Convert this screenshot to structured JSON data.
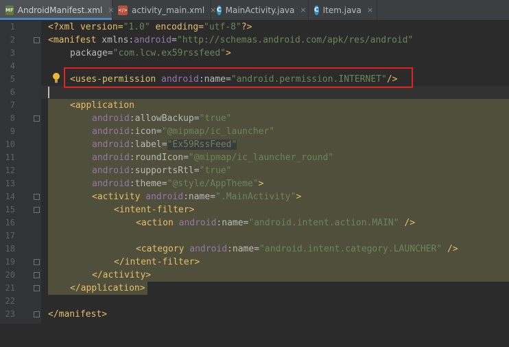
{
  "tabs": [
    {
      "label": "AndroidManifest.xml",
      "icon": "manifest-file-icon",
      "active": true
    },
    {
      "label": "activity_main.xml",
      "icon": "layout-xml-icon",
      "active": false
    },
    {
      "label": "MainActivity.java",
      "icon": "java-class-icon",
      "active": false
    },
    {
      "label": "Item.java",
      "icon": "java-class-icon",
      "active": false
    }
  ],
  "tab_close": "×",
  "lines": [
    {
      "n": "1"
    },
    {
      "n": "2"
    },
    {
      "n": "3"
    },
    {
      "n": "4"
    },
    {
      "n": "5"
    },
    {
      "n": "6"
    },
    {
      "n": "7"
    },
    {
      "n": "8"
    },
    {
      "n": "9"
    },
    {
      "n": "10"
    },
    {
      "n": "11"
    },
    {
      "n": "12"
    },
    {
      "n": "13"
    },
    {
      "n": "14"
    },
    {
      "n": "15"
    },
    {
      "n": "16"
    },
    {
      "n": "17"
    },
    {
      "n": "18"
    },
    {
      "n": "19"
    },
    {
      "n": "20"
    },
    {
      "n": "21"
    },
    {
      "n": "22"
    },
    {
      "n": "23"
    }
  ],
  "code": {
    "l1": {
      "a": "<?xml version=",
      "b": "\"1.0\"",
      "c": " encoding=",
      "d": "\"utf-8\"",
      "e": "?>"
    },
    "l2": {
      "a": "<manifest",
      "b": " xmlns:",
      "c": "android",
      "d": "=",
      "e": "\"http://schemas.android.com/apk/res/android\""
    },
    "l3": {
      "a": "package",
      "b": "=",
      "c": "\"com.lcw.ex59rssfeed\"",
      "d": ">"
    },
    "l5": {
      "a": "<uses-permission",
      "b": " android",
      "c": ":name=",
      "d": "\"android.permission.INTERNET\"",
      "e": "/>"
    },
    "l7": {
      "a": "<application"
    },
    "l8": {
      "a": "android",
      "b": ":allowBackup=",
      "c": "\"true\""
    },
    "l9": {
      "a": "android",
      "b": ":icon=",
      "c": "\"@mipmap/ic_launcher\""
    },
    "l10": {
      "a": "android",
      "b": ":label=",
      "c": "\"Ex59RssFeed\""
    },
    "l11": {
      "a": "android",
      "b": ":roundIcon=",
      "c": "\"@mipmap/ic_launcher_round\""
    },
    "l12": {
      "a": "android",
      "b": ":supportsRtl=",
      "c": "\"true\""
    },
    "l13": {
      "a": "android",
      "b": ":theme=",
      "c": "\"@style/AppTheme\"",
      "d": ">"
    },
    "l14": {
      "a": "<activity",
      "b": " android",
      "c": ":name=",
      "d": "\".MainActivity\"",
      "e": ">"
    },
    "l15": {
      "a": "<intent-filter>"
    },
    "l16": {
      "a": "<action",
      "b": " android",
      "c": ":name=",
      "d": "\"android.intent.action.MAIN\"",
      "e": " />"
    },
    "l18": {
      "a": "<category",
      "b": " android",
      "c": ":name=",
      "d": "\"android.intent.category.LAUNCHER\"",
      "e": " />"
    },
    "l19": {
      "a": "</intent-filter>"
    },
    "l20": {
      "a": "</activity>"
    },
    "l21": {
      "a": "</application>"
    },
    "l23": {
      "a": "</manifest>"
    }
  },
  "colors": {
    "highlight_box": "#e0231f",
    "selection_block": "#4f4f3b",
    "tab_accent": "#4a88c7"
  }
}
